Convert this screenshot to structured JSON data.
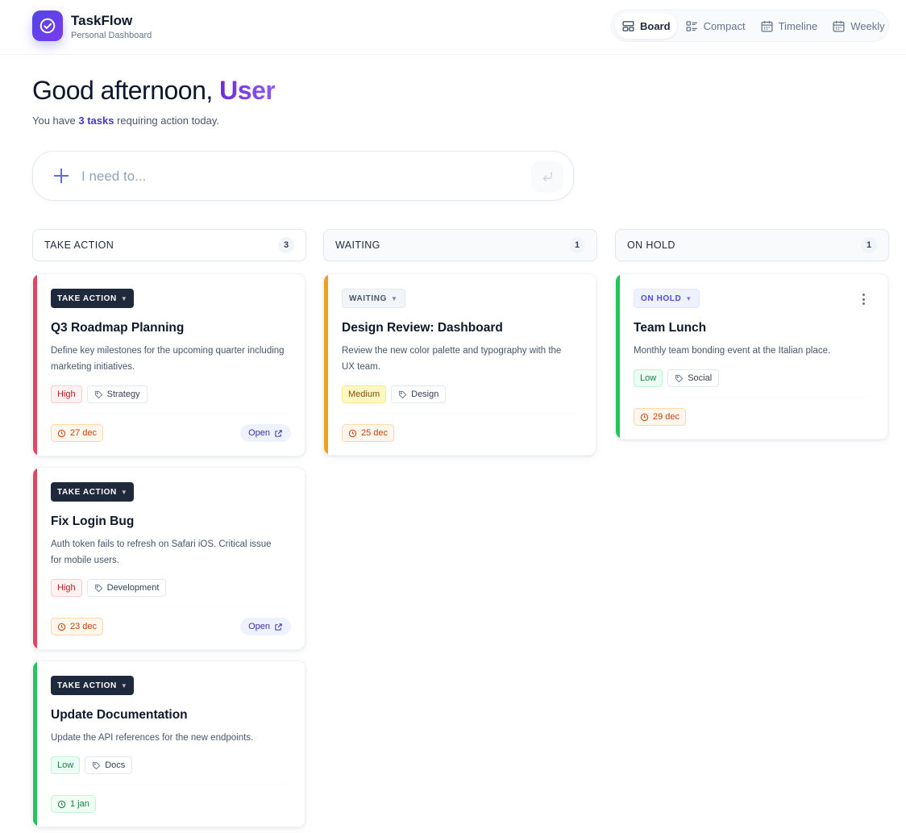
{
  "app": {
    "title": "TaskFlow",
    "subtitle": "Personal Dashboard"
  },
  "views": [
    {
      "label": "Board",
      "icon": "board-icon",
      "active": true
    },
    {
      "label": "Compact",
      "icon": "list-icon",
      "active": false
    },
    {
      "label": "Timeline",
      "icon": "calendar-icon",
      "active": false
    },
    {
      "label": "Weekly",
      "icon": "calendar-icon",
      "active": false
    }
  ],
  "greeting": {
    "prefix": "Good afternoon, ",
    "name": "User",
    "sub_before": "You have ",
    "count": "3 tasks",
    "sub_after": " requiring action today."
  },
  "quickadd": {
    "placeholder": "I need to..."
  },
  "columns": [
    {
      "title": "TAKE ACTION",
      "count": "3",
      "cards": [
        {
          "status": "TAKE ACTION",
          "title": "Q3 Roadmap Planning",
          "desc": "Define key milestones for the upcoming quarter including marketing initiatives.",
          "priority": "High",
          "category": "Strategy",
          "due": "27 dec",
          "open": "Open"
        },
        {
          "status": "TAKE ACTION",
          "title": "Fix Login Bug",
          "desc": "Auth token fails to refresh on Safari iOS. Critical issue for mobile users.",
          "priority": "High",
          "category": "Development",
          "due": "23 dec",
          "open": "Open"
        },
        {
          "status": "TAKE ACTION",
          "title": "Update Documentation",
          "desc": "Update the API references for the new endpoints.",
          "priority": "Low",
          "category": "Docs",
          "due": "1 jan"
        }
      ]
    },
    {
      "title": "WAITING",
      "count": "1",
      "cards": [
        {
          "status": "WAITING",
          "title": "Design Review: Dashboard",
          "desc": "Review the new color palette and typography with the UX team.",
          "priority": "Medium",
          "category": "Design",
          "due": "25 dec"
        }
      ]
    },
    {
      "title": "ON HOLD",
      "count": "1",
      "cards": [
        {
          "status": "ON HOLD",
          "title": "Team Lunch",
          "desc": "Monthly team bonding event at the Italian place.",
          "priority": "Low",
          "category": "Social",
          "due": "29 dec"
        }
      ]
    }
  ],
  "colors": {
    "accent": "#4f46e5",
    "high": "#e0475e",
    "medium": "#f0a020",
    "low": "#22c55e"
  }
}
